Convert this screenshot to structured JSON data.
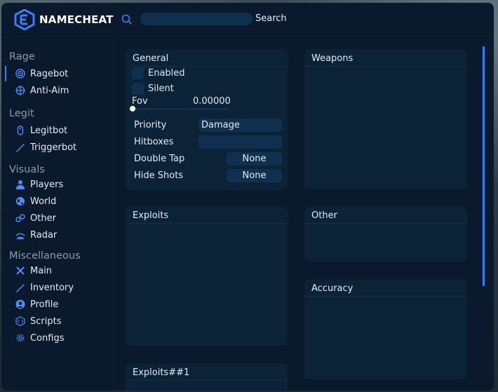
{
  "header": {
    "brand": "NAMECHEAT",
    "search": {
      "value": "",
      "button_label": "Search"
    }
  },
  "sidebar": {
    "sections": [
      {
        "title": "Rage",
        "items": [
          {
            "label": "Ragebot",
            "icon": "ragebot-icon",
            "active": true
          },
          {
            "label": "Anti-Aim",
            "icon": "anti-aim-icon"
          }
        ]
      },
      {
        "title": "Legit",
        "items": [
          {
            "label": "Legitbot",
            "icon": "legitbot-icon"
          },
          {
            "label": "Triggerbot",
            "icon": "triggerbot-icon"
          }
        ]
      },
      {
        "title": "Visuals",
        "items": [
          {
            "label": "Players",
            "icon": "players-icon"
          },
          {
            "label": "World",
            "icon": "world-icon"
          },
          {
            "label": "Other",
            "icon": "other-icon"
          },
          {
            "label": "Radar",
            "icon": "radar-icon"
          }
        ]
      },
      {
        "title": "Miscellaneous",
        "items": [
          {
            "label": "Main",
            "icon": "main-icon"
          },
          {
            "label": "Inventory",
            "icon": "inventory-icon"
          },
          {
            "label": "Profile",
            "icon": "profile-icon"
          },
          {
            "label": "Scripts",
            "icon": "scripts-icon"
          },
          {
            "label": "Configs",
            "icon": "configs-icon"
          }
        ]
      }
    ]
  },
  "panels": {
    "general": {
      "title": "General",
      "enabled": {
        "label": "Enabled",
        "checked": false
      },
      "silent": {
        "label": "Silent",
        "checked": false
      },
      "fov": {
        "label": "Fov",
        "value": "0.00000"
      },
      "priority": {
        "label": "Priority",
        "value": "Damage"
      },
      "hitboxes": {
        "label": "Hitboxes",
        "value": ""
      },
      "double_tap": {
        "label": "Double Tap",
        "value": "None"
      },
      "hide_shots": {
        "label": "Hide Shots",
        "value": "None"
      }
    },
    "weapons": {
      "title": "Weapons"
    },
    "exploits": {
      "title": "Exploits"
    },
    "other": {
      "title": "Other"
    },
    "accuracy": {
      "title": "Accuracy"
    },
    "exploits_1": {
      "title": "Exploits##1"
    }
  },
  "colors": {
    "accent": "#3d7cff",
    "window_bg": "#0a1a2c",
    "panel_bg": "#0c2236",
    "control_bg": "#10304f"
  }
}
